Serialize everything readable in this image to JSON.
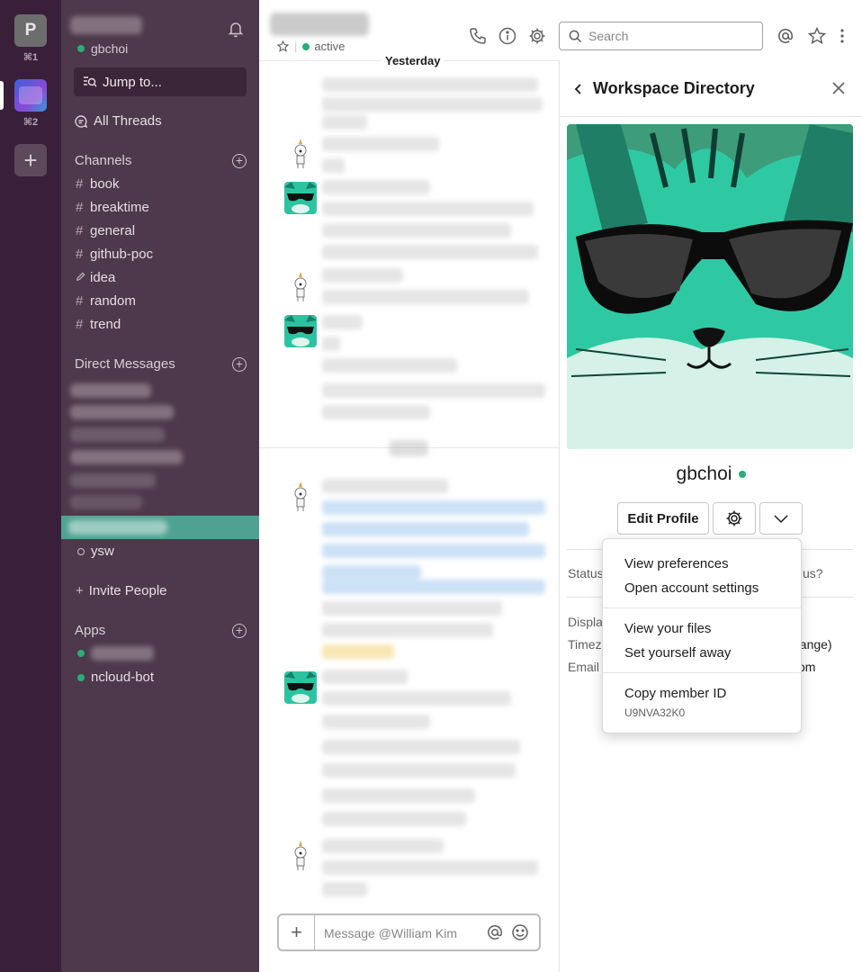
{
  "rail": {
    "workspace1_initial": "P",
    "workspace1_shortcut": "⌘1",
    "workspace2_shortcut": "⌘2",
    "add_label": "+"
  },
  "sidebar": {
    "current_user": "gbchoi",
    "jump_to": "Jump to...",
    "all_threads": "All Threads",
    "channels_header": "Channels",
    "channels": [
      {
        "icon": "#",
        "name": "book"
      },
      {
        "icon": "#",
        "name": "breaktime"
      },
      {
        "icon": "#",
        "name": "general"
      },
      {
        "icon": "#",
        "name": "github-poc"
      },
      {
        "icon": "pencil",
        "name": "idea"
      },
      {
        "icon": "#",
        "name": "random"
      },
      {
        "icon": "#",
        "name": "trend"
      }
    ],
    "dm_header": "Direct Messages",
    "dm_visible": "ysw",
    "invite": "Invite People",
    "apps_header": "Apps",
    "app_visible": "ncloud-bot"
  },
  "chat": {
    "presence": "active",
    "day_label": "Yesterday",
    "composer_placeholder": "Message @William Kim"
  },
  "header": {
    "search_placeholder": "Search"
  },
  "panel": {
    "title": "Workspace Directory",
    "profile_name": "gbchoi",
    "edit_profile": "Edit Profile",
    "field_fragments": {
      "status": "Status",
      "status_tail": "us?",
      "display": "Displa",
      "timezone": "Timez",
      "timezone_tail": "change)",
      "email": "Email",
      "email_tail": "om"
    }
  },
  "menu": {
    "items": [
      "View preferences",
      "Open account settings",
      "View your files",
      "Set yourself away",
      "Copy member ID"
    ],
    "member_id": "U9NVA32K0"
  },
  "colors": {
    "sidebar_bg": "#4d394b",
    "rail_bg": "#3a1f3a",
    "selected_dm": "#4fa291",
    "presence_green": "#2bac76"
  }
}
